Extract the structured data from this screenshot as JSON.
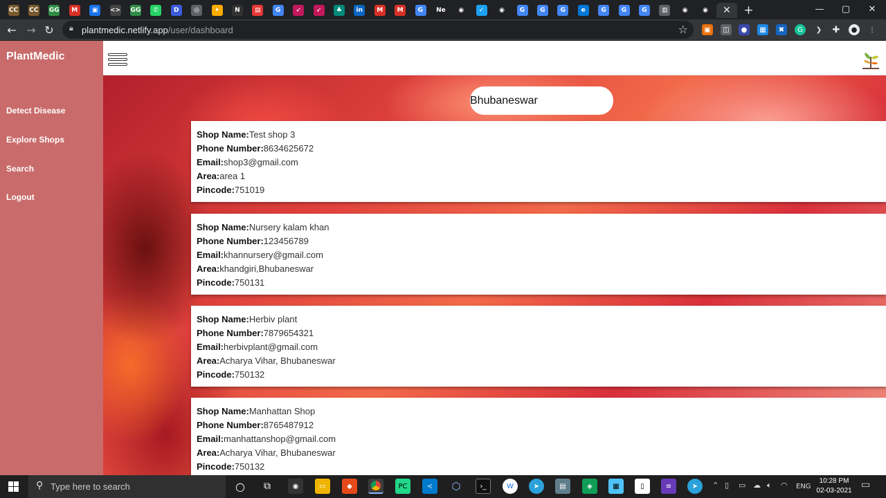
{
  "browser": {
    "tabs": [
      {
        "icon": "cc-icon",
        "glyph": "CC",
        "color": "#7a5a2e"
      },
      {
        "icon": "cc-icon",
        "glyph": "CC",
        "color": "#7a5a2e"
      },
      {
        "icon": "geeksforgeeks-icon",
        "glyph": "GG",
        "color": "#2f8d46"
      },
      {
        "icon": "gmail-icon",
        "glyph": "M",
        "color": "#d93025"
      },
      {
        "icon": "app-icon",
        "glyph": "▣",
        "color": "#1a73e8"
      },
      {
        "icon": "code-icon",
        "glyph": "<>",
        "color": "#444444"
      },
      {
        "icon": "geeksforgeeks-icon",
        "glyph": "GG",
        "color": "#2f8d46"
      },
      {
        "icon": "whatsapp-icon",
        "glyph": "✆",
        "color": "#25d366"
      },
      {
        "icon": "docs-icon",
        "glyph": "D",
        "color": "#3b5bdb"
      },
      {
        "icon": "globe-icon",
        "glyph": "◎",
        "color": "#5f6368"
      },
      {
        "icon": "bulb-icon",
        "glyph": "✦",
        "color": "#f9ab00"
      },
      {
        "icon": "notion-icon",
        "glyph": "N",
        "color": "#333333"
      },
      {
        "icon": "calendar-icon",
        "glyph": "▤",
        "color": "#e53935"
      },
      {
        "icon": "google-icon",
        "glyph": "G",
        "color": "#4285f4"
      },
      {
        "icon": "rocket-icon",
        "glyph": "➶",
        "color": "#c2185b"
      },
      {
        "icon": "rocket-icon",
        "glyph": "➶",
        "color": "#c2185b"
      },
      {
        "icon": "tree-icon",
        "glyph": "♣",
        "color": "#00897b"
      },
      {
        "icon": "linkedin-icon",
        "glyph": "in",
        "color": "#0a66c2"
      },
      {
        "icon": "gmail-icon",
        "glyph": "M",
        "color": "#d93025"
      },
      {
        "icon": "gmail-icon",
        "glyph": "M",
        "color": "#d93025"
      },
      {
        "icon": "google-icon",
        "glyph": "G",
        "color": "#4285f4"
      },
      {
        "icon": "netflix-icon",
        "glyph": "Ne",
        "color": "#202124"
      },
      {
        "icon": "github-icon",
        "glyph": "◉",
        "color": "#202124"
      },
      {
        "icon": "twitter-icon",
        "glyph": "✓",
        "color": "#1da1f2"
      },
      {
        "icon": "github-icon",
        "glyph": "◉",
        "color": "#202124"
      },
      {
        "icon": "google-icon",
        "glyph": "G",
        "color": "#4285f4"
      },
      {
        "icon": "google-icon",
        "glyph": "G",
        "color": "#4285f4"
      },
      {
        "icon": "google-icon",
        "glyph": "G",
        "color": "#4285f4"
      },
      {
        "icon": "edge-icon",
        "glyph": "e",
        "color": "#0078d7"
      },
      {
        "icon": "google-icon",
        "glyph": "G",
        "color": "#4285f4"
      },
      {
        "icon": "google-icon",
        "glyph": "G",
        "color": "#4285f4"
      },
      {
        "icon": "google-icon",
        "glyph": "G",
        "color": "#4285f4"
      },
      {
        "icon": "page-icon",
        "glyph": "▥",
        "color": "#5f6368"
      },
      {
        "icon": "github-icon",
        "glyph": "◉",
        "color": "#202124"
      },
      {
        "icon": "github-icon",
        "glyph": "◉",
        "color": "#202124"
      }
    ],
    "active_tab_close": "✕",
    "new_tab": "+",
    "url_host": "plantmedic.netlify.app",
    "url_path": "/user/dashboard"
  },
  "app": {
    "brand": "PlantMedic",
    "menu": [
      "Detect Disease",
      "Explore Shops",
      "Search",
      "Logout"
    ],
    "search_value": "Bhubaneswar",
    "labels": {
      "name": "Shop Name:",
      "phone": "Phone Number:",
      "email": "Email:",
      "area": "Area:",
      "pincode": "Pincode:"
    },
    "shops": [
      {
        "name": "Test shop 3",
        "phone": "8634625672",
        "email": "shop3@gmail.com",
        "area": "area 1",
        "pincode": "751019"
      },
      {
        "name": "Nursery kalam khan",
        "phone": "123456789",
        "email": "khannursery@gmail.com",
        "area": "khandgiri,Bhubaneswar",
        "pincode": "750131"
      },
      {
        "name": "Herbiv plant",
        "phone": "7879654321",
        "email": "herbivplant@gmail.com",
        "area": "Acharya Vihar, Bhubaneswar",
        "pincode": "750132"
      },
      {
        "name": "Manhattan Shop",
        "phone": "8765487912",
        "email": "manhattanshop@gmail.com",
        "area": "Acharya Vihar, Bhubaneswar",
        "pincode": "750132"
      }
    ]
  },
  "taskbar": {
    "search_placeholder": "Type here to search",
    "language": "ENG",
    "time": "10:28 PM",
    "date": "02-03-2021"
  }
}
